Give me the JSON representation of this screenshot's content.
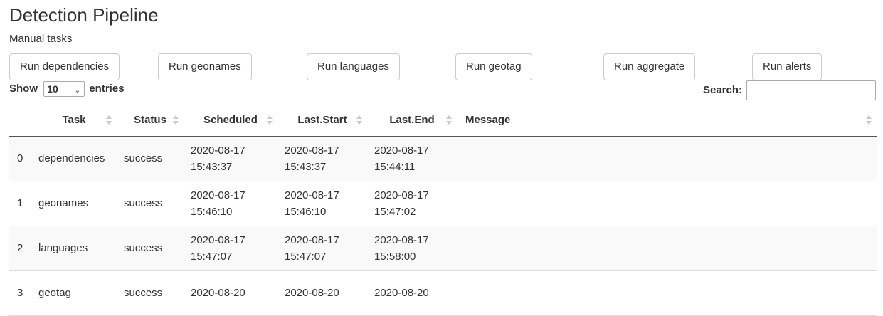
{
  "title": "Detection Pipeline",
  "subtitle": "Manual tasks",
  "buttons": [
    {
      "label": "Run dependencies"
    },
    {
      "label": "Run geonames"
    },
    {
      "label": "Run languages"
    },
    {
      "label": "Run geotag"
    },
    {
      "label": "Run aggregate"
    },
    {
      "label": "Run alerts"
    }
  ],
  "length_control": {
    "prefix": "Show",
    "value": "10",
    "suffix": "entries"
  },
  "search": {
    "label": "Search:",
    "value": ""
  },
  "table": {
    "columns": [
      "",
      "Task",
      "Status",
      "Scheduled",
      "Last.Start",
      "Last.End",
      "Message"
    ],
    "rows": [
      {
        "index": "0",
        "task": "dependencies",
        "status": "success",
        "scheduled_date": "2020-08-17",
        "scheduled_time": "15:43:37",
        "start_date": "2020-08-17",
        "start_time": "15:43:37",
        "end_date": "2020-08-17",
        "end_time": "15:44:11",
        "message": ""
      },
      {
        "index": "1",
        "task": "geonames",
        "status": "success",
        "scheduled_date": "2020-08-17",
        "scheduled_time": "15:46:10",
        "start_date": "2020-08-17",
        "start_time": "15:46:10",
        "end_date": "2020-08-17",
        "end_time": "15:47:02",
        "message": ""
      },
      {
        "index": "2",
        "task": "languages",
        "status": "success",
        "scheduled_date": "2020-08-17",
        "scheduled_time": "15:47:07",
        "start_date": "2020-08-17",
        "start_time": "15:47:07",
        "end_date": "2020-08-17",
        "end_time": "15:58:00",
        "message": ""
      },
      {
        "index": "3",
        "task": "geotag",
        "status": "success",
        "scheduled_date": "2020-08-20",
        "scheduled_time": "",
        "start_date": "2020-08-20",
        "start_time": "",
        "end_date": "2020-08-20",
        "end_time": "",
        "message": ""
      }
    ]
  }
}
